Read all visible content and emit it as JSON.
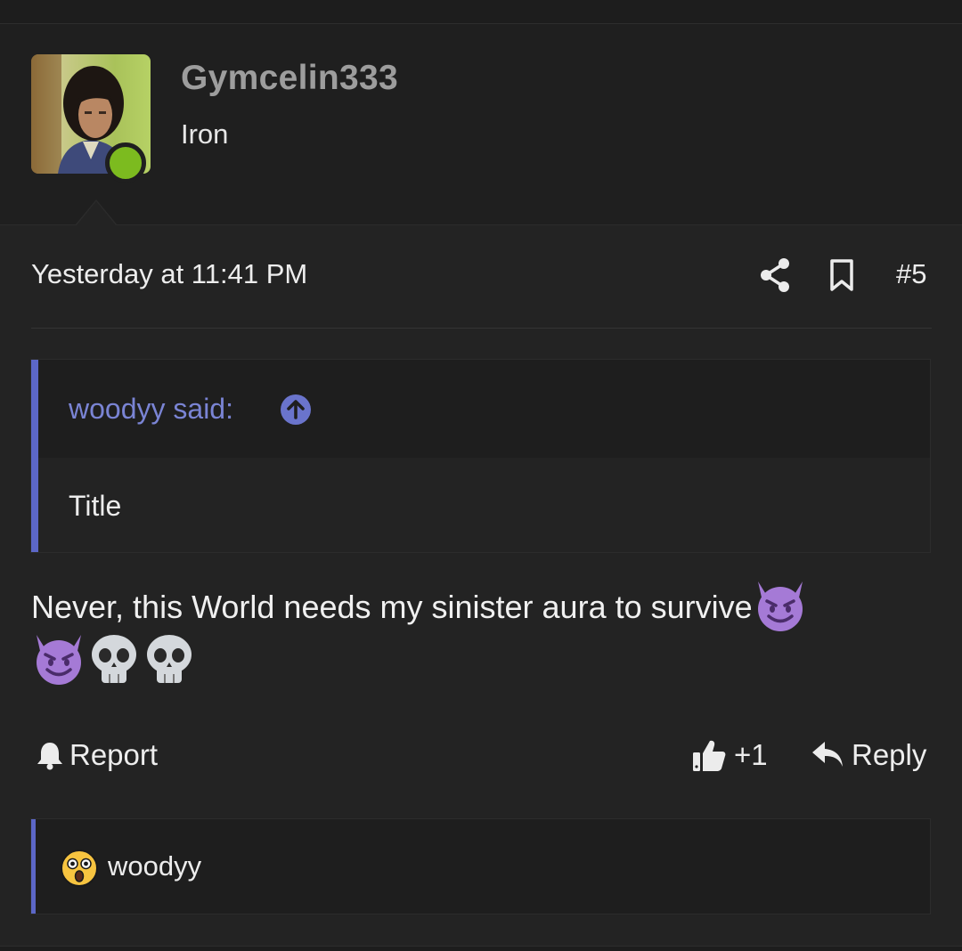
{
  "post": {
    "author": {
      "username": "Gymcelin333",
      "user_title": "Iron",
      "online_status": "online",
      "online_color": "#7cbb1f"
    },
    "timestamp": "Yesterday at 11:41 PM",
    "post_number": "#5",
    "actions_top": {
      "share_icon": "share-icon",
      "bookmark_icon": "bookmark-icon"
    },
    "quote": {
      "author_label": "woodyy said:",
      "jump_icon": "arrow-up-circle-icon",
      "text": "Title",
      "accent_color": "#5c67c7"
    },
    "message": {
      "text": "Never, this World needs my sinister aura to survive",
      "emojis_inline": [
        "smiling-imp-emoji"
      ],
      "emojis_line2": [
        "smiling-imp-emoji",
        "skull-emoji",
        "skull-emoji"
      ]
    },
    "footer": {
      "report_label": "Report",
      "like_count": "+1",
      "reply_label": "Reply"
    },
    "reactions": {
      "emoji": "astonished-face-emoji",
      "users": "woodyy"
    }
  }
}
